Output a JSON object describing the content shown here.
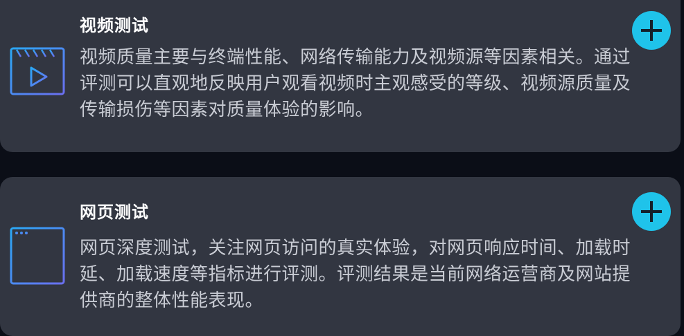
{
  "cards": [
    {
      "title": "视频测试",
      "description": "视频质量主要与终端性能、网络传输能力及视频源等因素相关。通过评测可以直观地反映用户观看视频时主观感受的等级、视频源质量及传输损伤等因素对质量体验的影响。",
      "icon": "video-clapper-icon",
      "action_icon": "plus-icon"
    },
    {
      "title": "网页测试",
      "description": "网页深度测试，关注网页访问的真实体验，对网页响应时间、加载时延、加载速度等指标进行评测。评测结果是当前网络运营商及网站提供商的整体性能表现。",
      "icon": "browser-window-icon",
      "action_icon": "plus-icon"
    }
  ],
  "colors": {
    "card_background": "#323641",
    "page_background": "#0b0e17",
    "accent": "#1fc3ea",
    "icon_gradient_start": "#2aa8f5",
    "icon_gradient_end": "#6b6ff0",
    "title_text": "#ffffff",
    "body_text": "#c9ccd4"
  }
}
